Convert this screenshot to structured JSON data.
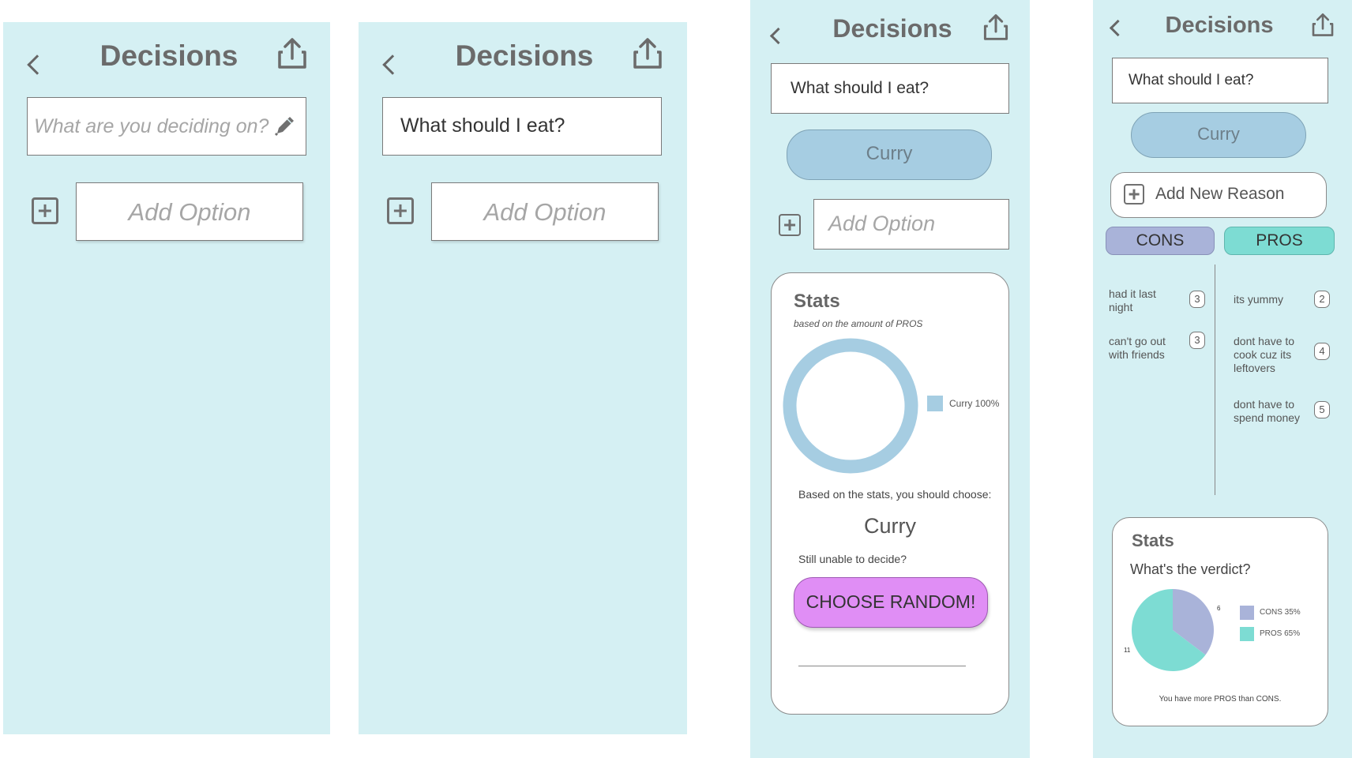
{
  "app": {
    "title": "Decisions",
    "question": "What should I eat?",
    "placeholder": "What are you deciding on?",
    "add_option": "Add Option"
  },
  "screen3": {
    "option": "Curry",
    "stats_title": "Stats",
    "stats_subtitle": "based on the amount of PROS",
    "legend": "Curry 100%",
    "based_on": "Based on the stats, you should choose:",
    "result": "Curry",
    "unable": "Still unable to decide?",
    "random_button": "CHOOSE RANDOM!"
  },
  "screen4": {
    "option": "Curry",
    "add_reason": "Add New Reason",
    "cons_label": "CONS",
    "pros_label": "PROS",
    "cons": [
      {
        "text": "had it last night",
        "score": "3"
      },
      {
        "text": "can't go out with friends",
        "score": "3"
      }
    ],
    "pros": [
      {
        "text": "its yummy",
        "score": "2"
      },
      {
        "text": "dont have to cook cuz its leftovers",
        "score": "4"
      },
      {
        "text": "dont have to spend money",
        "score": "5"
      }
    ],
    "stats_title": "Stats",
    "verdict": "What's the verdict?",
    "legend_cons": "CONS 35%",
    "legend_pros": "PROS 65%",
    "slice_label_cons": "6",
    "slice_label_pros": "11",
    "summary": "You have more PROS than CONS."
  },
  "colors": {
    "screen_bg": "#d5f0f3",
    "option_pill": "#a6cde2",
    "cons": "#a9b3d9",
    "pros": "#7ddcd3",
    "random_button": "#e08ef5"
  },
  "chart_data": [
    {
      "type": "pie",
      "title": "Stats",
      "subtitle": "based on the amount of PROS",
      "categories": [
        "Curry"
      ],
      "values": [
        100
      ],
      "style": "donut"
    },
    {
      "type": "pie",
      "title": "Stats",
      "subtitle": "What's the verdict?",
      "categories": [
        "CONS",
        "PROS"
      ],
      "values": [
        6,
        11
      ],
      "percent_labels": [
        "CONS 35%",
        "PROS 65%"
      ]
    }
  ]
}
